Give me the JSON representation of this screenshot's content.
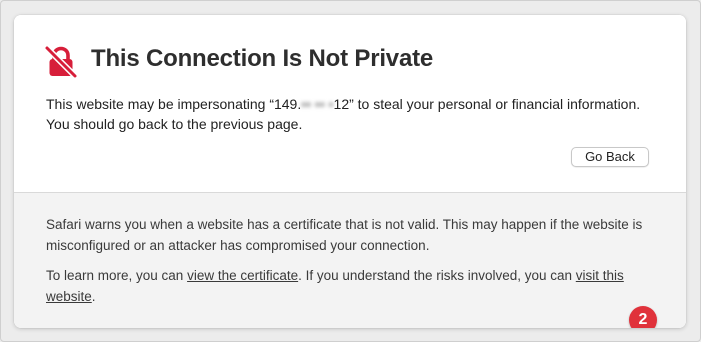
{
  "colors": {
    "warning_red": "#d71e3a",
    "badge_red": "#e0323b",
    "title_text": "#2e2e2e",
    "body_text": "#222222",
    "secondary_text": "#3a3a3a",
    "panel_bg": "#f3f3f3"
  },
  "icon": {
    "name": "lock-slash-icon"
  },
  "header": {
    "title": "This Connection Is Not Private"
  },
  "warning": {
    "text_before": "This website may be impersonating “149.",
    "ip_obscured": "•• •• •",
    "text_after": "12” to steal your personal or financial information. You should go back to the previous page."
  },
  "actions": {
    "go_back_label": "Go Back"
  },
  "details": {
    "paragraph1": "Safari warns you when a website has a certificate that is not valid. This may happen if the website is misconfigured or an attacker has compromised your connection.",
    "p2_before": "To learn more, you can ",
    "view_certificate_link": "view the certificate",
    "p2_middle": ". If you understand the risks involved, you can ",
    "visit_website_link": "visit this website",
    "p2_after": "."
  },
  "annotation": {
    "badge_label": "2"
  }
}
